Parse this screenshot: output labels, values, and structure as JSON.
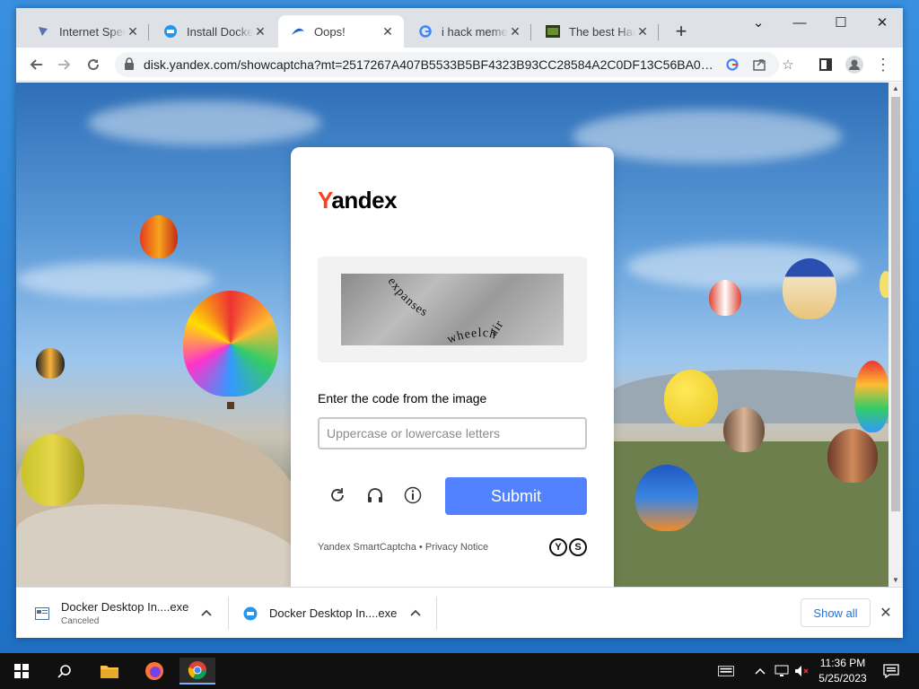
{
  "browser": {
    "tabs": [
      {
        "label": "Internet Speed",
        "icon": "speedtest-icon",
        "active": false
      },
      {
        "label": "Install Docker",
        "icon": "docker-icon",
        "active": false
      },
      {
        "label": "Oops!",
        "icon": "yandex-disk-icon",
        "active": true
      },
      {
        "label": "i hack memez",
        "icon": "google-icon",
        "active": false
      },
      {
        "label": "The best Hacke",
        "icon": "site-icon",
        "active": false
      }
    ],
    "new_tab": "+",
    "url": "disk.yandex.com/showcaptcha?mt=2517267A407B5533B5BF4323B93CC28584A2C0DF13C56BA04F73...",
    "window_controls": {
      "chevron": "⌄",
      "minimize": "—",
      "maximize": "☐",
      "close": "✕"
    }
  },
  "captcha": {
    "logo_first": "Y",
    "logo_rest": "andex",
    "captcha_text_1": "expanses",
    "captcha_text_2": "wheelchair",
    "prompt": "Enter the code from the image",
    "input_placeholder": "Uppercase or lowercase letters",
    "input_value": "",
    "submit_label": "Submit",
    "footer": "Yandex SmartCaptcha • Privacy Notice",
    "footer_logo_1": "Y",
    "footer_logo_2": "S"
  },
  "downloads": [
    {
      "name": "Docker Desktop In....exe",
      "status": "Canceled"
    },
    {
      "name": "Docker Desktop In....exe",
      "status": ""
    }
  ],
  "shelf": {
    "show_all": "Show all"
  },
  "taskbar": {
    "time": "11:36 PM",
    "date": "5/25/2023"
  },
  "colors": {
    "yandex_red": "#fc3f1d",
    "submit_blue": "#5282ff",
    "link_blue": "#1a73e8"
  }
}
